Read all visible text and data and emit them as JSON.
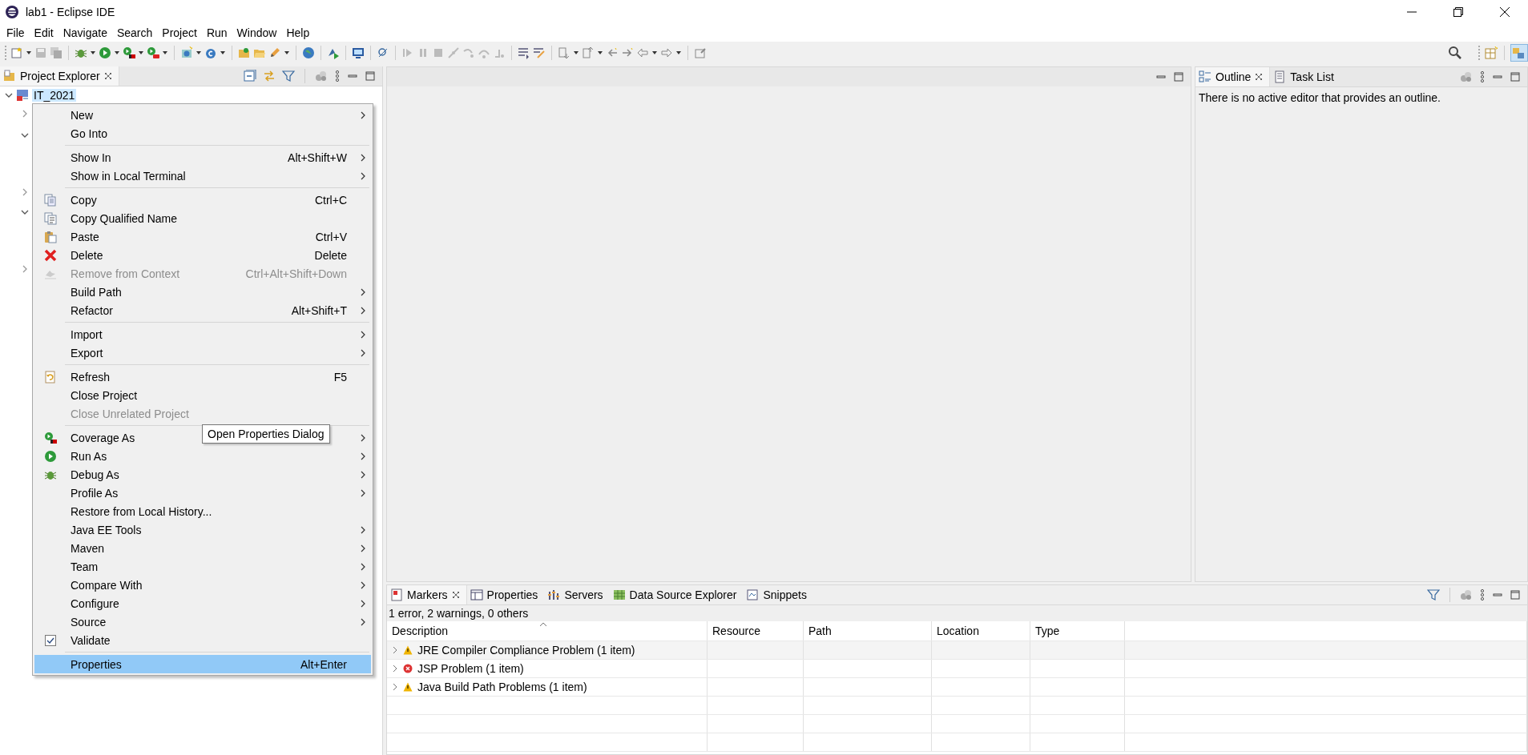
{
  "window": {
    "title": "lab1 - Eclipse IDE"
  },
  "menu_bar": [
    "File",
    "Edit",
    "Navigate",
    "Search",
    "Project",
    "Run",
    "Window",
    "Help"
  ],
  "project_explorer": {
    "tab": {
      "label": "Project Explorer",
      "selected": true
    },
    "tree": [
      {
        "label": "IT_2021",
        "expanded": true,
        "selected": true,
        "children": [
          {
            "expanded": false
          },
          {
            "expanded": true
          },
          {
            "expanded": false
          },
          {
            "expanded": true
          },
          {
            "expanded": false
          }
        ]
      }
    ]
  },
  "context_menu": {
    "items": [
      {
        "kind": "item",
        "label": "New",
        "submenu": true,
        "disabled": false,
        "selected": false
      },
      {
        "kind": "item",
        "label": "Go Into",
        "submenu": false,
        "disabled": false,
        "selected": false
      },
      {
        "kind": "separator"
      },
      {
        "kind": "item",
        "label": "Show In",
        "shortcut": "Alt+Shift+W",
        "submenu": true,
        "disabled": false,
        "selected": false
      },
      {
        "kind": "item",
        "label": "Show in Local Terminal",
        "submenu": true,
        "disabled": false,
        "selected": false
      },
      {
        "kind": "separator"
      },
      {
        "kind": "item",
        "label": "Copy",
        "shortcut": "Ctrl+C",
        "submenu": false,
        "disabled": false,
        "selected": false
      },
      {
        "kind": "item",
        "label": "Copy Qualified Name",
        "submenu": false,
        "disabled": false,
        "selected": false
      },
      {
        "kind": "item",
        "label": "Paste",
        "shortcut": "Ctrl+V",
        "submenu": false,
        "disabled": false,
        "selected": false
      },
      {
        "kind": "item",
        "label": "Delete",
        "shortcut": "Delete",
        "submenu": false,
        "disabled": false,
        "selected": false
      },
      {
        "kind": "item",
        "label": "Remove from Context",
        "shortcut": "Ctrl+Alt+Shift+Down",
        "submenu": false,
        "disabled": true,
        "selected": false
      },
      {
        "kind": "item",
        "label": "Build Path",
        "submenu": true,
        "disabled": false,
        "selected": false
      },
      {
        "kind": "item",
        "label": "Refactor",
        "shortcut": "Alt+Shift+T",
        "submenu": true,
        "disabled": false,
        "selected": false
      },
      {
        "kind": "separator"
      },
      {
        "kind": "item",
        "label": "Import",
        "submenu": true,
        "disabled": false,
        "selected": false
      },
      {
        "kind": "item",
        "label": "Export",
        "submenu": true,
        "disabled": false,
        "selected": false
      },
      {
        "kind": "separator"
      },
      {
        "kind": "item",
        "label": "Refresh",
        "shortcut": "F5",
        "submenu": false,
        "disabled": false,
        "selected": false
      },
      {
        "kind": "item",
        "label": "Close Project",
        "submenu": false,
        "disabled": false,
        "selected": false
      },
      {
        "kind": "item",
        "label": "Close Unrelated Project",
        "submenu": false,
        "disabled": true,
        "selected": false
      },
      {
        "kind": "separator"
      },
      {
        "kind": "item",
        "label": "Coverage As",
        "submenu": true,
        "disabled": false,
        "selected": false
      },
      {
        "kind": "item",
        "label": "Run As",
        "submenu": true,
        "disabled": false,
        "selected": false
      },
      {
        "kind": "item",
        "label": "Debug As",
        "submenu": true,
        "disabled": false,
        "selected": false
      },
      {
        "kind": "item",
        "label": "Profile As",
        "submenu": true,
        "disabled": false,
        "selected": false
      },
      {
        "kind": "item",
        "label": "Restore from Local History...",
        "submenu": false,
        "disabled": false,
        "selected": false
      },
      {
        "kind": "item",
        "label": "Java EE Tools",
        "submenu": true,
        "disabled": false,
        "selected": false
      },
      {
        "kind": "item",
        "label": "Maven",
        "submenu": true,
        "disabled": false,
        "selected": false
      },
      {
        "kind": "item",
        "label": "Team",
        "submenu": true,
        "disabled": false,
        "selected": false
      },
      {
        "kind": "item",
        "label": "Compare With",
        "submenu": true,
        "disabled": false,
        "selected": false
      },
      {
        "kind": "item",
        "label": "Configure",
        "submenu": true,
        "disabled": false,
        "selected": false
      },
      {
        "kind": "item",
        "label": "Source",
        "submenu": true,
        "disabled": false,
        "selected": false
      },
      {
        "kind": "check",
        "label": "Validate",
        "checked": true,
        "submenu": false,
        "disabled": false,
        "selected": false
      },
      {
        "kind": "separator"
      },
      {
        "kind": "item",
        "label": "Properties",
        "shortcut": "Alt+Enter",
        "submenu": false,
        "disabled": false,
        "selected": true
      }
    ]
  },
  "tooltip": "Open Properties Dialog",
  "outline": {
    "tabs": [
      {
        "label": "Outline",
        "selected": true
      },
      {
        "label": "Task List",
        "selected": false
      }
    ],
    "message": "There is no active editor that provides an outline."
  },
  "markers": {
    "tabs": [
      {
        "label": "Markers",
        "selected": true
      },
      {
        "label": "Properties",
        "selected": false
      },
      {
        "label": "Servers",
        "selected": false
      },
      {
        "label": "Data Source Explorer",
        "selected": false
      },
      {
        "label": "Snippets",
        "selected": false
      }
    ],
    "summary": "1 error, 2 warnings, 0 others",
    "columns": [
      "Description",
      "Resource",
      "Path",
      "Location",
      "Type"
    ],
    "rows": [
      {
        "kind": "warning",
        "description": "JRE Compiler Compliance Problem (1 item)",
        "expanded": false
      },
      {
        "kind": "error",
        "description": "JSP Problem (1 item)",
        "expanded": false
      },
      {
        "kind": "warning",
        "description": "Java Build Path Problems (1 item)",
        "expanded": false
      }
    ]
  }
}
